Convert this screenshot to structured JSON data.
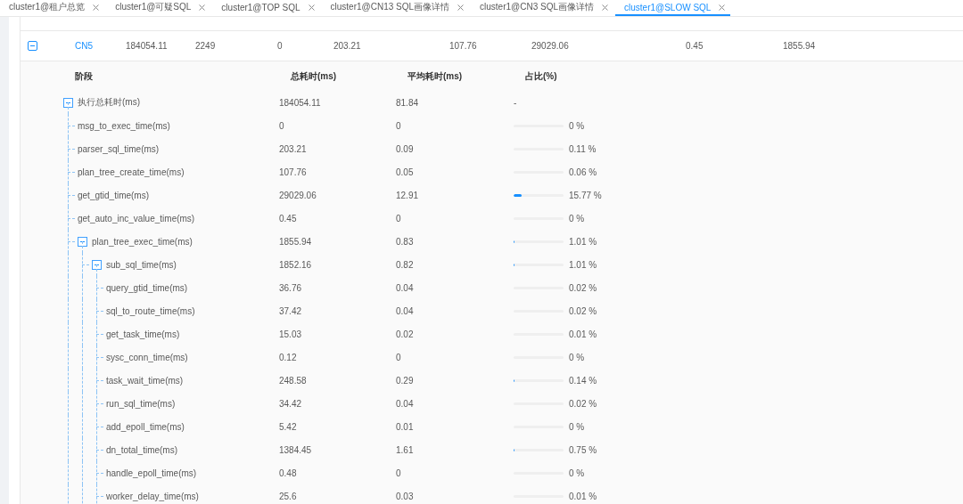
{
  "tabs": [
    {
      "label": "cluster1@租户总览",
      "selected": false
    },
    {
      "label": "cluster1@可疑SQL",
      "selected": false
    },
    {
      "label": "cluster1@TOP SQL",
      "selected": false
    },
    {
      "label": "cluster1@CN13 SQL画像详情",
      "selected": false
    },
    {
      "label": "cluster1@CN3 SQL画像详情",
      "selected": false
    },
    {
      "label": "cluster1@SLOW SQL",
      "selected": true
    }
  ],
  "table": {
    "rows": [
      {
        "expanded": true,
        "node": "CN5",
        "cells": [
          "184054.11",
          "2249",
          "0",
          "203.21",
          "107.76",
          "29029.06",
          "0.45",
          "1855.94"
        ]
      }
    ]
  },
  "detail": {
    "columns": [
      "阶段",
      "总耗时(ms)",
      "平均耗时(ms)",
      "占比(%)"
    ],
    "tree": [
      {
        "name": "执行总耗时(ms)",
        "total": "184054.11",
        "avg": "81.84",
        "ratio": "-",
        "expanded": true,
        "children": [
          {
            "name": "msg_to_exec_time(ms)",
            "total": "0",
            "avg": "0",
            "ratio": "0 %",
            "level": 0
          },
          {
            "name": "parser_sql_time(ms)",
            "total": "203.21",
            "avg": "0.09",
            "ratio": "0.11 %",
            "level": 0.0011
          },
          {
            "name": "plan_tree_create_time(ms)",
            "total": "107.76",
            "avg": "0.05",
            "ratio": "0.06 %",
            "level": 0.0006
          },
          {
            "name": "get_gtid_time(ms)",
            "total": "29029.06",
            "avg": "12.91",
            "ratio": "15.77 %",
            "level": 0.1577
          },
          {
            "name": "get_auto_inc_value_time(ms)",
            "total": "0.45",
            "avg": "0",
            "ratio": "0 %",
            "level": 0
          },
          {
            "name": "plan_tree_exec_time(ms)",
            "total": "1855.94",
            "avg": "0.83",
            "ratio": "1.01 %",
            "level": 0.0101,
            "expanded": true,
            "children": [
              {
                "name": "sub_sql_time(ms)",
                "total": "1852.16",
                "avg": "0.82",
                "ratio": "1.01 %",
                "level": 0.0101,
                "expanded": true,
                "children": [
                  {
                    "name": "query_gtid_time(ms)",
                    "total": "36.76",
                    "avg": "0.04",
                    "ratio": "0.02 %",
                    "level": 0.0002
                  },
                  {
                    "name": "sql_to_route_time(ms)",
                    "total": "37.42",
                    "avg": "0.04",
                    "ratio": "0.02 %",
                    "level": 0.0002
                  },
                  {
                    "name": "get_task_time(ms)",
                    "total": "15.03",
                    "avg": "0.02",
                    "ratio": "0.01 %",
                    "level": 0.0001
                  },
                  {
                    "name": "sysc_conn_time(ms)",
                    "total": "0.12",
                    "avg": "0",
                    "ratio": "0 %",
                    "level": 0
                  },
                  {
                    "name": "task_wait_time(ms)",
                    "total": "248.58",
                    "avg": "0.29",
                    "ratio": "0.14 %",
                    "level": 0.0014
                  },
                  {
                    "name": "run_sql_time(ms)",
                    "total": "34.42",
                    "avg": "0.04",
                    "ratio": "0.02 %",
                    "level": 0.0002
                  },
                  {
                    "name": "add_epoll_time(ms)",
                    "total": "5.42",
                    "avg": "0.01",
                    "ratio": "0 %",
                    "level": 0
                  },
                  {
                    "name": "dn_total_time(ms)",
                    "total": "1384.45",
                    "avg": "1.61",
                    "ratio": "0.75 %",
                    "level": 0.0075
                  },
                  {
                    "name": "handle_epoll_time(ms)",
                    "total": "0.48",
                    "avg": "0",
                    "ratio": "0 %",
                    "level": 0
                  },
                  {
                    "name": "worker_delay_time(ms)",
                    "total": "25.6",
                    "avg": "0.03",
                    "ratio": "0.01 %",
                    "level": 0.0001
                  }
                ]
              }
            ]
          }
        ]
      }
    ]
  }
}
